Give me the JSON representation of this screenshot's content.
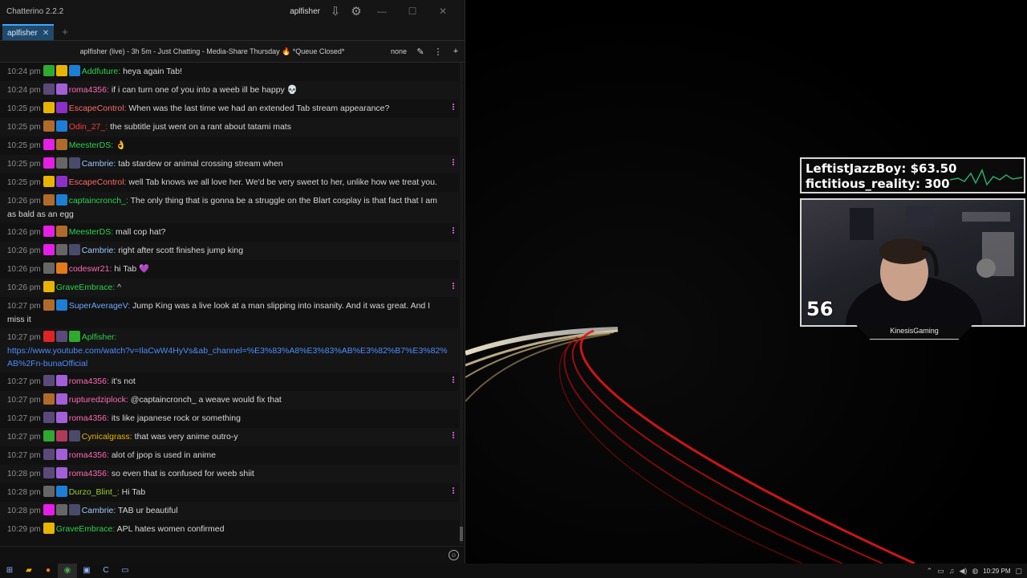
{
  "window": {
    "title": "Chatterino 2.2.2",
    "user": "aplfisher",
    "controls": {
      "minimize": "—",
      "maximize": "☐",
      "close": "✕"
    }
  },
  "tabs": [
    {
      "label": "aplfisher",
      "close": "✕"
    }
  ],
  "tab_add": "+",
  "channel": {
    "title": "aplfisher (live) - 3h 5m - Just Chatting - Media-Share Thursday 🔥 *Queue Closed*",
    "mode": "none"
  },
  "messages": [
    {
      "time": "10:24 pm",
      "badges": [
        "#2eaa2e",
        "#e8b400",
        "#1c7ed6"
      ],
      "user": "Addfuture:",
      "color": "#2dd24f",
      "text": " heya again Tab!"
    },
    {
      "time": "10:24 pm",
      "badges": [
        "#5a4a7a",
        "#a35fd8"
      ],
      "user": "roma4356:",
      "color": "#ff69b4",
      "text": " if i can turn one of you into a weeb ill be happy 💀"
    },
    {
      "time": "10:25 pm",
      "badges": [
        "#e8b400",
        "#8b2fc9"
      ],
      "user": "EscapeControl:",
      "color": "#ff6a6a",
      "text": " When was the last time we had an extended Tab stream appearance?"
    },
    {
      "time": "10:25 pm",
      "badges": [
        "#b06a2a",
        "#1c7ed6"
      ],
      "user": "Odin_27_:",
      "color": "#ff3b3b",
      "text": " the subtitle just went on a rant about tatami mats"
    },
    {
      "time": "10:25 pm",
      "badges": [
        "#e61ee6",
        "#b06a2a"
      ],
      "user": "MeesterDS:",
      "color": "#2dd24f",
      "text": " 👌"
    },
    {
      "time": "10:25 pm",
      "badges": [
        "#e61ee6",
        "#666666",
        "#4a4a6a"
      ],
      "user": "Cambrie:",
      "color": "#9ec8ff",
      "text": " tab stardew or animal crossing stream when"
    },
    {
      "time": "10:25 pm",
      "badges": [
        "#e8b400",
        "#8b2fc9"
      ],
      "user": "EscapeControl:",
      "color": "#ff6a6a",
      "text": " well Tab knows we all love her. We'd be very sweet to her, unlike how we treat you."
    },
    {
      "time": "10:26 pm",
      "badges": [
        "#b06a2a",
        "#1c7ed6"
      ],
      "user": "captaincronch_:",
      "color": "#2dd24f",
      "text": " The only thing that is gonna be a struggle on the Blart cosplay is that fact that I am as bald as an egg"
    },
    {
      "time": "10:26 pm",
      "badges": [
        "#e61ee6",
        "#b06a2a"
      ],
      "user": "MeesterDS:",
      "color": "#2dd24f",
      "text": " mall cop hat?"
    },
    {
      "time": "10:26 pm",
      "badges": [
        "#e61ee6",
        "#666666",
        "#4a4a6a"
      ],
      "user": "Cambrie:",
      "color": "#9ec8ff",
      "text": " right after scott finishes jump king"
    },
    {
      "time": "10:26 pm",
      "badges": [
        "#666666",
        "#e07a1a"
      ],
      "user": "codeswr21:",
      "color": "#ff69b4",
      "text": " hi Tab 💜"
    },
    {
      "time": "10:26 pm",
      "badges": [
        "#e8b400"
      ],
      "user": "GraveEmbrace:",
      "color": "#2dd24f",
      "text": " ^"
    },
    {
      "time": "10:27 pm",
      "badges": [
        "#b06a2a",
        "#1c7ed6"
      ],
      "user": "SuperAverageV:",
      "color": "#6fa8ff",
      "text": " Jump King was a live look at a man slipping into insanity. And it was great. And I miss it"
    },
    {
      "time": "10:27 pm",
      "badges": [
        "#e02424",
        "#5a4a7a",
        "#2eaa2e"
      ],
      "user": "Aplfisher:",
      "color": "#2dd24f",
      "text": "",
      "link": "https://www.youtube.com/watch?v=IlaCwW4HyVs&ab_channel=%E3%83%A8%E3%83%AB%E3%82%B7%E3%82%AB%2Fn-bunaOfficial"
    },
    {
      "time": "10:27 pm",
      "badges": [
        "#5a4a7a",
        "#a35fd8"
      ],
      "user": "roma4356:",
      "color": "#ff69b4",
      "text": " it's not"
    },
    {
      "time": "10:27 pm",
      "badges": [
        "#b06a2a",
        "#a35fd8"
      ],
      "user": "rupturedziplock:",
      "color": "#ff69b4",
      "text": " @captaincronch_ a weave would fix that"
    },
    {
      "time": "10:27 pm",
      "badges": [
        "#5a4a7a",
        "#a35fd8"
      ],
      "user": "roma4356:",
      "color": "#ff69b4",
      "text": " its like japanese rock or something"
    },
    {
      "time": "10:27 pm",
      "badges": [
        "#2eaa2e",
        "#b03a5a",
        "#4a4a6a"
      ],
      "user": "Cynicalgrass:",
      "color": "#e8b400",
      "text": " that was very anime outro-y"
    },
    {
      "time": "10:27 pm",
      "badges": [
        "#5a4a7a",
        "#a35fd8"
      ],
      "user": "roma4356:",
      "color": "#ff69b4",
      "text": " alot of jpop is used in anime"
    },
    {
      "time": "10:28 pm",
      "badges": [
        "#5a4a7a",
        "#a35fd8"
      ],
      "user": "roma4356:",
      "color": "#ff69b4",
      "text": " so even that is confused for weeb shiit"
    },
    {
      "time": "10:28 pm",
      "badges": [
        "#666666",
        "#1c7ed6"
      ],
      "user": "Durzo_Blint_:",
      "color": "#9acd32",
      "text": " Hi Tab"
    },
    {
      "time": "10:28 pm",
      "badges": [
        "#e61ee6",
        "#666666",
        "#4a4a6a"
      ],
      "user": "Cambrie:",
      "color": "#9ec8ff",
      "text": " TAB ur beautiful"
    },
    {
      "time": "10:29 pm",
      "badges": [
        "#e8b400"
      ],
      "user": "GraveEmbrace:",
      "color": "#2dd24f",
      "text": " APL hates women confirmed"
    }
  ],
  "stream": {
    "donations": [
      "LeftistJazzBoy: $63.50",
      "fictitious_reality: 300"
    ],
    "webcam_count": "56",
    "brand": "KinesisGaming"
  },
  "taskbar": {
    "clock": "10:29 PM"
  }
}
